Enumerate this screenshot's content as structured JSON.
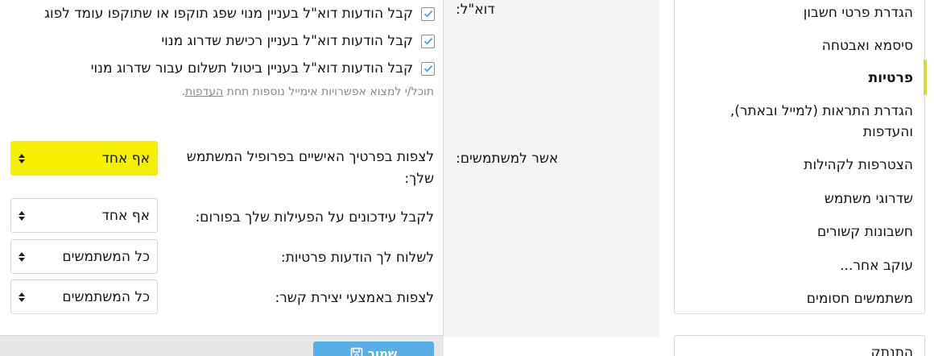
{
  "sidebar": {
    "items": [
      {
        "label": "הגדרת פרטי חשבון",
        "active": false
      },
      {
        "label": "סיסמא ואבטחה",
        "active": false
      },
      {
        "label": "פרטיות",
        "active": true
      },
      {
        "label": "הגדרת התראות (למייל ובאתר),",
        "active": false
      },
      {
        "label": "והעדפות",
        "active": false
      },
      {
        "label": "הצטרפות לקהילות",
        "active": false
      },
      {
        "label": "שדרוגי משתמש",
        "active": false
      },
      {
        "label": "חשבונות קשורים",
        "active": false
      },
      {
        "label": "עוקב אחר...",
        "active": false
      },
      {
        "label": "משתמשים חסומים",
        "active": false
      }
    ],
    "logout_label": "התנתק",
    "accent_color": "#d7d73a"
  },
  "email_section": {
    "label": "דוא\"ל:",
    "checkboxes": [
      {
        "text": "קבל הודעות דוא\"ל בעניין מנוי שפג תוקפו או שתוקפו עומד לפוג",
        "checked": true
      },
      {
        "text": "קבל הודעות דוא\"ל בעניין רכישת שדרוג מנוי",
        "checked": true
      },
      {
        "text": "קבל הודעות דוא\"ל בעניין ביטול תשלום עבור שדרוג מנוי",
        "checked": true
      }
    ],
    "hint_prefix": "תוכל/י למצוא אפשרויות אימייל נוספות תחת ",
    "hint_link": "העדפות",
    "hint_suffix": "."
  },
  "users_section": {
    "label": "אשר למשתמשים:",
    "rows": [
      {
        "label_line1": "לצפות בפרטיך האישיים בפרופיל המשתמש",
        "label_line2": "שלך:",
        "value": "אף אחד",
        "highlighted": true
      },
      {
        "label_line1": "לקבל עידכונים על הפעילות שלך בפורום:",
        "label_line2": "",
        "value": "אף אחד",
        "highlighted": false
      },
      {
        "label_line1": "לשלוח לך הודעות פרטיות:",
        "label_line2": "",
        "value": "כל המשתמשים",
        "highlighted": false
      },
      {
        "label_line1": "לצפות באמצעי יצירת קשר:",
        "label_line2": "",
        "value": "כל המשתמשים",
        "highlighted": false
      }
    ]
  },
  "footer": {
    "save_label": "שמור",
    "save_icon": "floppy-disk-icon",
    "button_color": "#5aaee6"
  },
  "colors": {
    "checkbox": "#4aa3e0",
    "highlight": "#f5ef00"
  }
}
